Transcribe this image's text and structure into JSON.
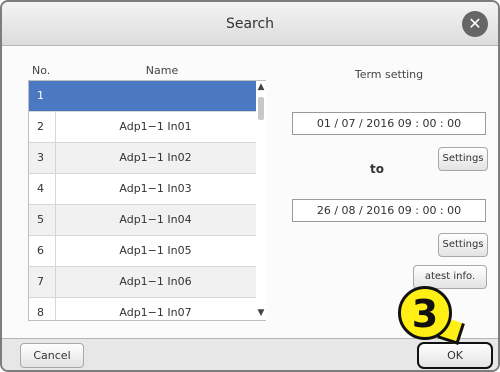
{
  "dialog": {
    "title": "Search"
  },
  "list": {
    "columns": {
      "no": "No.",
      "name": "Name"
    },
    "rows": [
      {
        "no": "1",
        "name": ""
      },
      {
        "no": "2",
        "name": "Adp1−1 In01"
      },
      {
        "no": "3",
        "name": "Adp1−1 In02"
      },
      {
        "no": "4",
        "name": "Adp1−1 In03"
      },
      {
        "no": "5",
        "name": "Adp1−1 In04"
      },
      {
        "no": "6",
        "name": "Adp1−1 In05"
      },
      {
        "no": "7",
        "name": "Adp1−1 In06"
      },
      {
        "no": "8",
        "name": "Adp1−1 In07"
      }
    ],
    "scrollbar": {
      "up_icon": "▲",
      "down_icon": "▼"
    }
  },
  "term": {
    "label": "Term setting",
    "start": "01 / 07 / 2016 09 : 00 : 00",
    "to_label": "to",
    "end": "26 / 08 / 2016 09 : 00 : 00",
    "settings_label": "Settings",
    "latest_label": "atest info."
  },
  "callout": {
    "number": "3"
  },
  "footer": {
    "cancel_label": "Cancel",
    "ok_label": "OK"
  },
  "colors": {
    "selected_row": "#4a79c2",
    "callout": "#ffef14"
  }
}
